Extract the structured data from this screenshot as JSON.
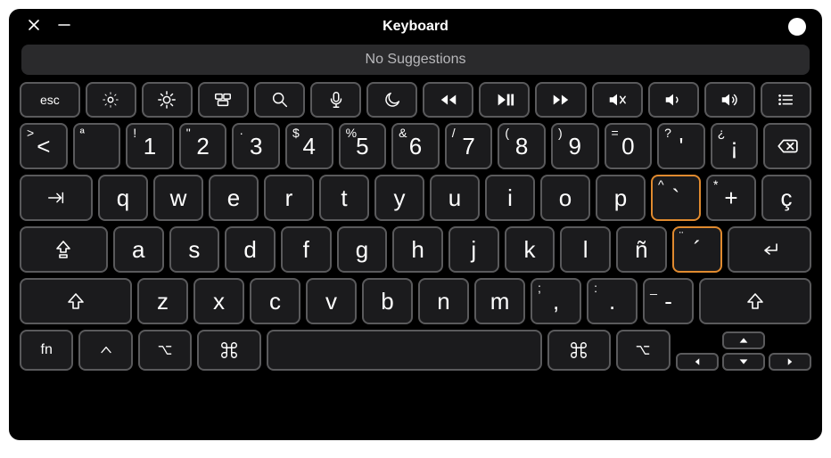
{
  "window": {
    "title": "Keyboard"
  },
  "suggestions": {
    "text": "No Suggestions"
  },
  "fn_row": {
    "esc": "esc",
    "icons": [
      "brightness-down",
      "brightness-up",
      "mission-control",
      "spotlight",
      "dictation",
      "do-not-disturb",
      "rewind",
      "play-pause",
      "fast-forward",
      "mute",
      "volume-down",
      "volume-up",
      "list"
    ]
  },
  "num_row": [
    {
      "tl": ">",
      "main": "<",
      "tr": ""
    },
    {
      "tl": "ª",
      "main": "",
      "tr": ""
    },
    {
      "tl": "!",
      "main": "1",
      "tr": ""
    },
    {
      "tl": "\"",
      "main": "2",
      "tr": ""
    },
    {
      "tl": "·",
      "main": "3",
      "tr": ""
    },
    {
      "tl": "$",
      "main": "4",
      "tr": ""
    },
    {
      "tl": "%",
      "main": "5",
      "tr": ""
    },
    {
      "tl": "&",
      "main": "6",
      "tr": ""
    },
    {
      "tl": "/",
      "main": "7",
      "tr": ""
    },
    {
      "tl": "(",
      "main": "8",
      "tr": ""
    },
    {
      "tl": ")",
      "main": "9",
      "tr": ""
    },
    {
      "tl": "=",
      "main": "0",
      "tr": ""
    },
    {
      "tl": "?",
      "main": "'",
      "tr": ""
    },
    {
      "tl": "¿",
      "main": "¡",
      "tr": ""
    }
  ],
  "qwerty_row": {
    "letters": [
      "q",
      "w",
      "e",
      "r",
      "t",
      "y",
      "u",
      "i",
      "o",
      "p"
    ],
    "dead1": {
      "tl": "^",
      "main": "`"
    },
    "plus": {
      "tl": "*",
      "main": "+"
    },
    "ccedilla": {
      "tl": "",
      "main": "ç"
    }
  },
  "asdf_row": {
    "letters": [
      "a",
      "s",
      "d",
      "f",
      "g",
      "h",
      "j",
      "k",
      "l",
      "ñ"
    ],
    "dead2": {
      "tl": "¨",
      "main": "´"
    }
  },
  "zxcv_row": {
    "letters": [
      "z",
      "x",
      "c",
      "v",
      "b",
      "n",
      "m"
    ],
    "comma": {
      "tl": ";",
      "main": ","
    },
    "period": {
      "tl": ":",
      "main": "."
    },
    "dash": {
      "tl": "_",
      "main": "-"
    }
  },
  "mods": {
    "fn": "fn"
  }
}
